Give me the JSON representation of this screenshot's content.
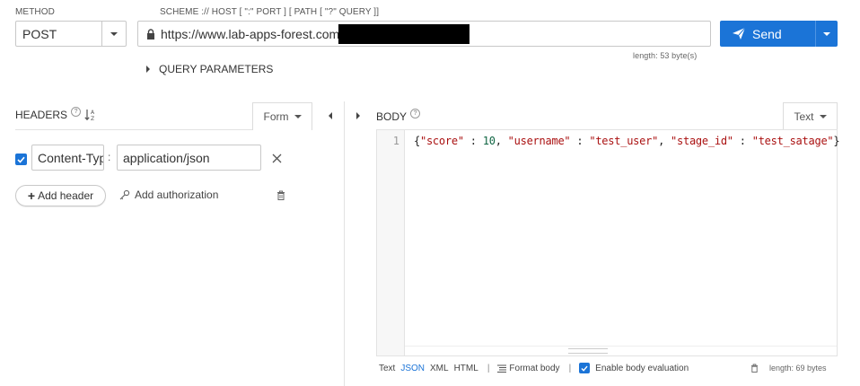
{
  "request": {
    "method_label": "METHOD",
    "method_value": "POST",
    "url_label": "SCHEME :// HOST [ \":\" PORT ] [ PATH [ \"?\" QUERY ]]",
    "url_value": "https://www.lab-apps-forest.com",
    "url_length": "length: 53 byte(s)",
    "send_label": "Send",
    "query_params_label": "QUERY PARAMETERS"
  },
  "headers": {
    "title": "HEADERS",
    "help": "?",
    "mode_label": "Form",
    "items": [
      {
        "enabled": true,
        "name": "Content-Type",
        "value": "application/json"
      }
    ],
    "add_header_label": "Add header",
    "add_auth_label": "Add authorization"
  },
  "body": {
    "title": "BODY",
    "help": "?",
    "mode_label": "Text",
    "line_number": "1",
    "code": {
      "open": "{",
      "k1": "\"score\"",
      "v1": "10",
      "k2": "\"username\"",
      "v2": "\"test_user\"",
      "k3": "\"stage_id\"",
      "v3": "\"test_satage\"",
      "close": "}"
    },
    "footer": {
      "formats": [
        "Text",
        "JSON",
        "XML",
        "HTML"
      ],
      "active_format": "JSON",
      "format_body_label": "Format body",
      "enable_eval_label": "Enable body evaluation",
      "enable_eval_checked": true,
      "length": "length: 69 bytes"
    }
  },
  "colors": {
    "accent": "#1b74d7"
  }
}
